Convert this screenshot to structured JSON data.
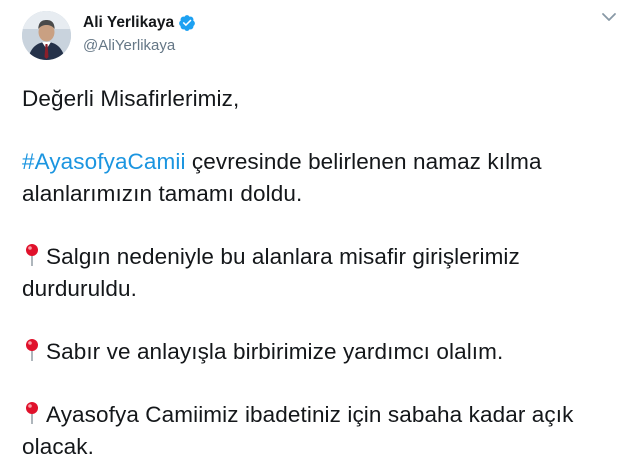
{
  "user": {
    "display_name": "Ali Yerlikaya",
    "handle": "@AliYerlikaya",
    "verified": true,
    "verified_color": "#1da1f2"
  },
  "icons": {
    "verified": "verified-badge-icon",
    "menu": "chevron-down-icon",
    "pin": "round-pushpin-icon"
  },
  "tweet": {
    "greeting": "Değerli Misafirlerimiz,",
    "hashtag": "#AyasofyaCamii",
    "line1_rest": " çevresinde belirlenen namaz kılma alanlarımızın tamamı doldu.",
    "line2": "Salgın nedeniyle bu alanlara misafir girişlerimiz durduruldu.",
    "line3": "Sabır ve anlayışla birbirimize yardımcı olalım.",
    "line4": "Ayasofya Camiimiz ibadetiniz için sabaha kadar açık olacak."
  },
  "colors": {
    "text": "#14171a",
    "secondary": "#657786",
    "link": "#1b95e0",
    "pin": "#e0112b"
  }
}
